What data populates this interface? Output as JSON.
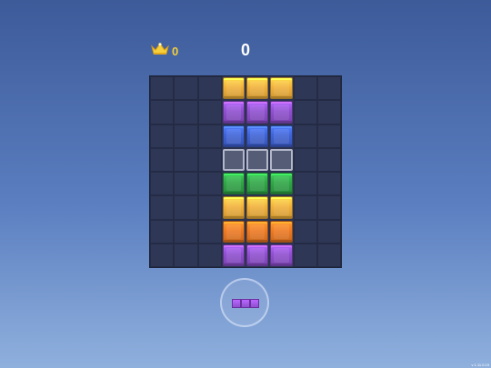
{
  "hud": {
    "best_score": "0",
    "score": "0",
    "crown_icon": "crown-icon"
  },
  "colors": {
    "yellow": "#f2b13a",
    "purple": "#8f4fcf",
    "blue": "#3f63d6",
    "green": "#2fa646",
    "orange": "#ef7a22",
    "ghost": "#7c8296"
  },
  "board": {
    "rows": 8,
    "cols": 8,
    "grid": [
      [
        ".",
        ".",
        ".",
        "yellow",
        "yellow",
        "yellow",
        ".",
        "."
      ],
      [
        ".",
        ".",
        ".",
        "purple",
        "purple",
        "purple",
        ".",
        "."
      ],
      [
        ".",
        ".",
        ".",
        "blue",
        "blue",
        "blue",
        ".",
        "."
      ],
      [
        ".",
        ".",
        ".",
        "ghost",
        "ghost",
        "ghost",
        ".",
        "."
      ],
      [
        ".",
        ".",
        ".",
        "green",
        "green",
        "green",
        ".",
        "."
      ],
      [
        ".",
        ".",
        ".",
        "yellow",
        "yellow",
        "yellow",
        ".",
        "."
      ],
      [
        ".",
        ".",
        ".",
        "orange",
        "orange",
        "orange",
        ".",
        "."
      ],
      [
        ".",
        ".",
        ".",
        "purple",
        "purple",
        "purple",
        ".",
        "."
      ]
    ]
  },
  "tray": {
    "piece_color": "purple",
    "piece_cells": 3
  },
  "footer": {
    "left_text": "",
    "version": "v 1.11.0.19"
  }
}
